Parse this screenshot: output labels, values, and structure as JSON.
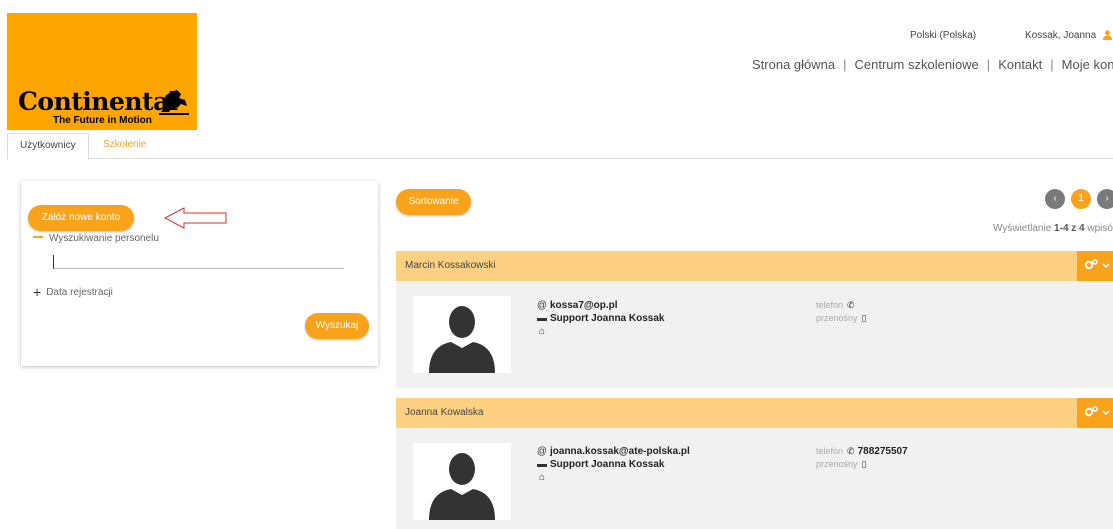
{
  "brand": {
    "name": "Continental",
    "tagline": "The Future in Motion",
    "color": "#ffa500"
  },
  "header": {
    "language": "Polski (Polska)",
    "user": "Kossak, Joanna",
    "nav": [
      "Strona główna",
      "Centrum szkoleniowe",
      "Kontakt",
      "Moje konto"
    ]
  },
  "tabs": [
    {
      "label": "Użytkownicy",
      "active": true
    },
    {
      "label": "Szkolenie",
      "active": false
    }
  ],
  "left_panel": {
    "new_account_label": "Załóż nowe konto",
    "personnel_search_label": "Wyszukiwanie personelu",
    "search_value": "",
    "registration_date_label": "Data rejestracji",
    "search_button_label": "Wyszukaj"
  },
  "results": {
    "sort_label": "Sortowanie",
    "pager": {
      "prev": "‹",
      "current": "1",
      "next": "›"
    },
    "showing_prefix": "Wyświetlanie ",
    "showing_range": "1-4 z 4",
    "showing_suffix": " wpisów"
  },
  "users": [
    {
      "name": "Marcin Kossakowski",
      "email": "kossa7@op.pl",
      "department": "Support Joanna Kossak",
      "phone_label": "telefon",
      "phone": "",
      "mobile_label": "przenośny",
      "mobile": ""
    },
    {
      "name": "Joanna Kowalska",
      "email": "joanna.kossak@ate-polska.pl",
      "department": "Support Joanna Kossak",
      "phone_label": "telefon",
      "phone": "788275507",
      "mobile_label": "przenośny",
      "mobile": ""
    }
  ],
  "colors": {
    "accent": "#f9a21b",
    "card_header": "#fdd082",
    "annotation_arrow": "#e0302a"
  }
}
